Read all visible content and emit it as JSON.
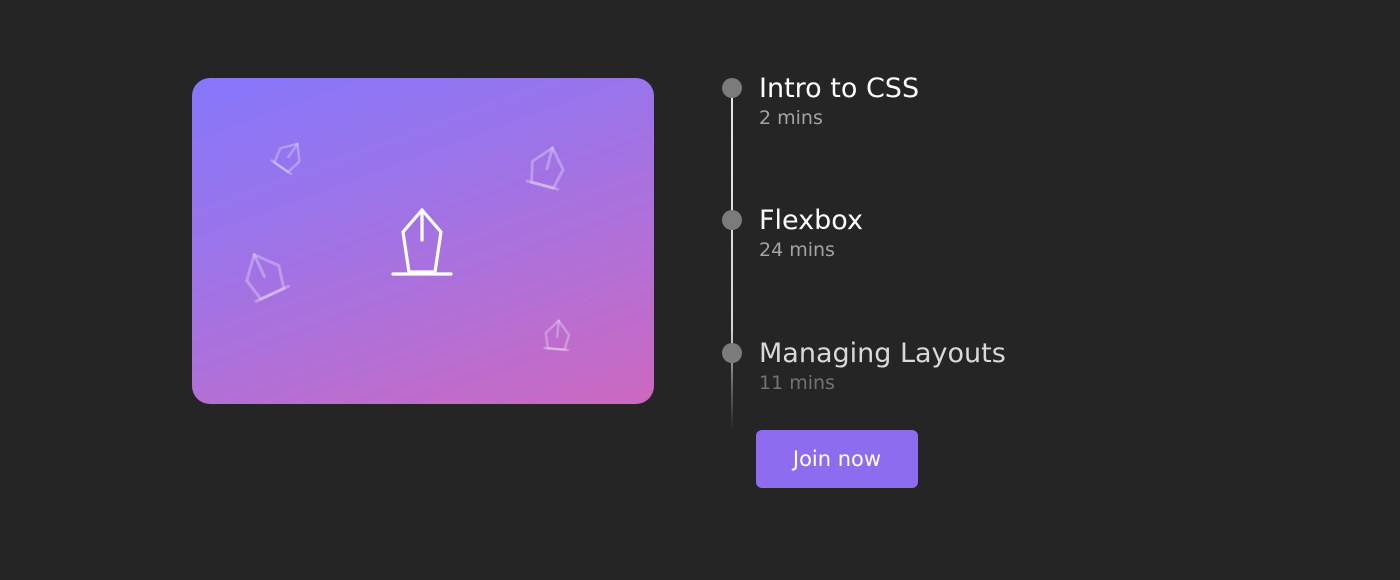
{
  "course_card": {
    "main_icon": "pen-tool-icon",
    "decor_icons": [
      "pen-tool-icon",
      "pen-tool-icon",
      "pen-tool-icon",
      "pen-tool-icon"
    ],
    "gradient_colors": [
      "#8677fb",
      "#cc68c0"
    ]
  },
  "timeline": {
    "lessons": [
      {
        "title": "Intro to CSS",
        "duration": "2 mins"
      },
      {
        "title": "Flexbox",
        "duration": "24 mins"
      },
      {
        "title": "Managing Layouts",
        "duration": "11 mins"
      }
    ]
  },
  "cta": {
    "join_label": "Join now",
    "color": "#8e6cef"
  }
}
